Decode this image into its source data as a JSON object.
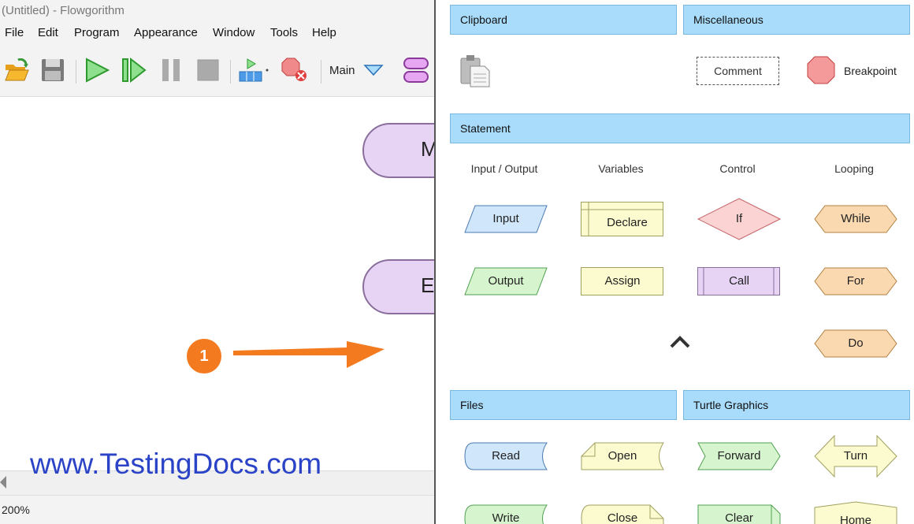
{
  "app": {
    "title": "(Untitled) - Flowgorithm",
    "menu": [
      "File",
      "Edit",
      "Program",
      "Appearance",
      "Window",
      "Tools",
      "Help"
    ],
    "toolbar": {
      "function_select": "Main",
      "icons": [
        "open-icon",
        "save-icon",
        "run-icon",
        "step-icon",
        "pause-icon",
        "stop-icon",
        "variable-watch-icon",
        "clear-breakpoints-icon",
        "dropdown-triangle-icon",
        "add-function-icon"
      ]
    },
    "canvas": {
      "nodes": [
        {
          "label": "M",
          "kind": "start"
        },
        {
          "label": "E",
          "kind": "end"
        }
      ]
    },
    "status": {
      "zoom": "200%"
    }
  },
  "annotation": {
    "badge": "1",
    "color": "#f47a1f"
  },
  "watermark": "www.TestingDocs.com",
  "palette": {
    "sections": {
      "clipboard": "Clipboard",
      "misc": "Miscellaneous",
      "statement": "Statement",
      "files": "Files",
      "turtle": "Turtle Graphics"
    },
    "misc_items": {
      "comment": "Comment",
      "breakpoint": "Breakpoint"
    },
    "columns": [
      "Input / Output",
      "Variables",
      "Control",
      "Looping"
    ],
    "statements": {
      "input": "Input",
      "output": "Output",
      "declare": "Declare",
      "assign": "Assign",
      "if": "If",
      "call": "Call",
      "while": "While",
      "for": "For",
      "do": "Do"
    },
    "files": {
      "read": "Read",
      "write": "Write",
      "open": "Open",
      "close": "Close"
    },
    "turtle": {
      "forward": "Forward",
      "clear": "Clear",
      "turn": "Turn",
      "home": "Home"
    },
    "colors": {
      "section": "#a9dcfa",
      "io": "#cfe6fb",
      "output": "#d6f5cf",
      "variables": "#fbfbcf",
      "control": "#fbd3d3",
      "call": "#e7d4f5",
      "loop": "#fbd9b0",
      "turtle": "#d6f5cf"
    }
  }
}
